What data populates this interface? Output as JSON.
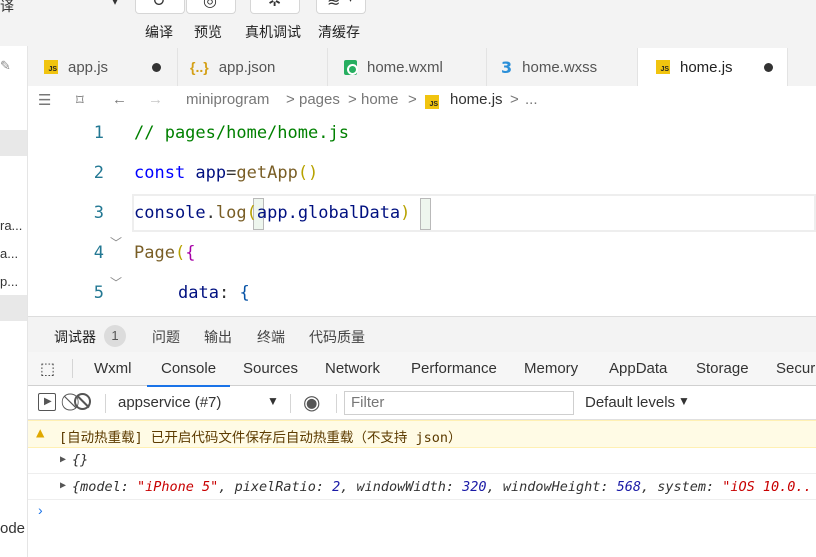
{
  "toolbar": {
    "partial_label": "译",
    "compile_label": "编译",
    "preview_label": "预览",
    "remote_debug_label": "真机调试",
    "clear_cache_label": "清缓存"
  },
  "tabs": [
    {
      "name": "app.js",
      "icon": "js-icon",
      "dirty": true,
      "active": false
    },
    {
      "name": "app.json",
      "icon": "json-icon",
      "dirty": false,
      "active": false
    },
    {
      "name": "home.wxml",
      "icon": "wxml-icon",
      "dirty": false,
      "active": false
    },
    {
      "name": "home.wxss",
      "icon": "css-icon",
      "dirty": false,
      "active": false
    },
    {
      "name": "home.js",
      "icon": "js-icon",
      "dirty": true,
      "active": true
    }
  ],
  "breadcrumb": {
    "items": [
      "miniprogram",
      "pages",
      "home",
      "home.js",
      "..."
    ],
    "separator": ">"
  },
  "editor": {
    "line_numbers": [
      "1",
      "2",
      "3",
      "4",
      "5"
    ],
    "lines": {
      "l1": "// pages/home/home.js",
      "l2_kw": "const",
      "l2_id": " app",
      "l2_eq": "=",
      "l2_fn": "getApp",
      "l2_paren": "()",
      "l3_obj": "console",
      "l3_dot": ".",
      "l3_fn": "log",
      "l3_open": "(",
      "l3_arg": "app.globalData",
      "l3_close": ")",
      "l4_fn": "Page",
      "l4_paren": "(",
      "l4_brace": "{",
      "l5_key": "data",
      "l5_colon": ": ",
      "l5_brace": "{"
    }
  },
  "debugger": {
    "panel_tabs": [
      "调试器",
      "问题",
      "输出",
      "终端",
      "代码质量"
    ],
    "badge_count": "1",
    "dev_tabs": [
      "Wxml",
      "Console",
      "Sources",
      "Network",
      "Performance",
      "Memory",
      "AppData",
      "Storage",
      "Securi"
    ],
    "active_dev_tab": "Console",
    "context": "appservice (#7)",
    "filter_placeholder": "Filter",
    "levels": "Default levels"
  },
  "console": {
    "warning": "[自动热重载] 已开启代码文件保存后自动热重载（不支持 json）",
    "log1": "{}",
    "log2": {
      "prefix": "{model: ",
      "model": "\"iPhone 5\"",
      "pixelRatio_label": ", pixelRatio: ",
      "pixelRatio": "2",
      "windowWidth_label": ", windowWidth: ",
      "windowWidth": "320",
      "windowHeight_label": ", windowHeight: ",
      "windowHeight": "568",
      "system_label": ", system: ",
      "system": "\"iOS 10.0.."
    }
  },
  "left_strip": [
    "ra...",
    "a...",
    "p...",
    "ode"
  ],
  "colors": {
    "accent": "#1a73e8",
    "warning_bg": "#fffbe5",
    "js_yellow": "#f1c40f",
    "wxml_green": "#27ae60",
    "css_blue": "#2b8fd8"
  }
}
